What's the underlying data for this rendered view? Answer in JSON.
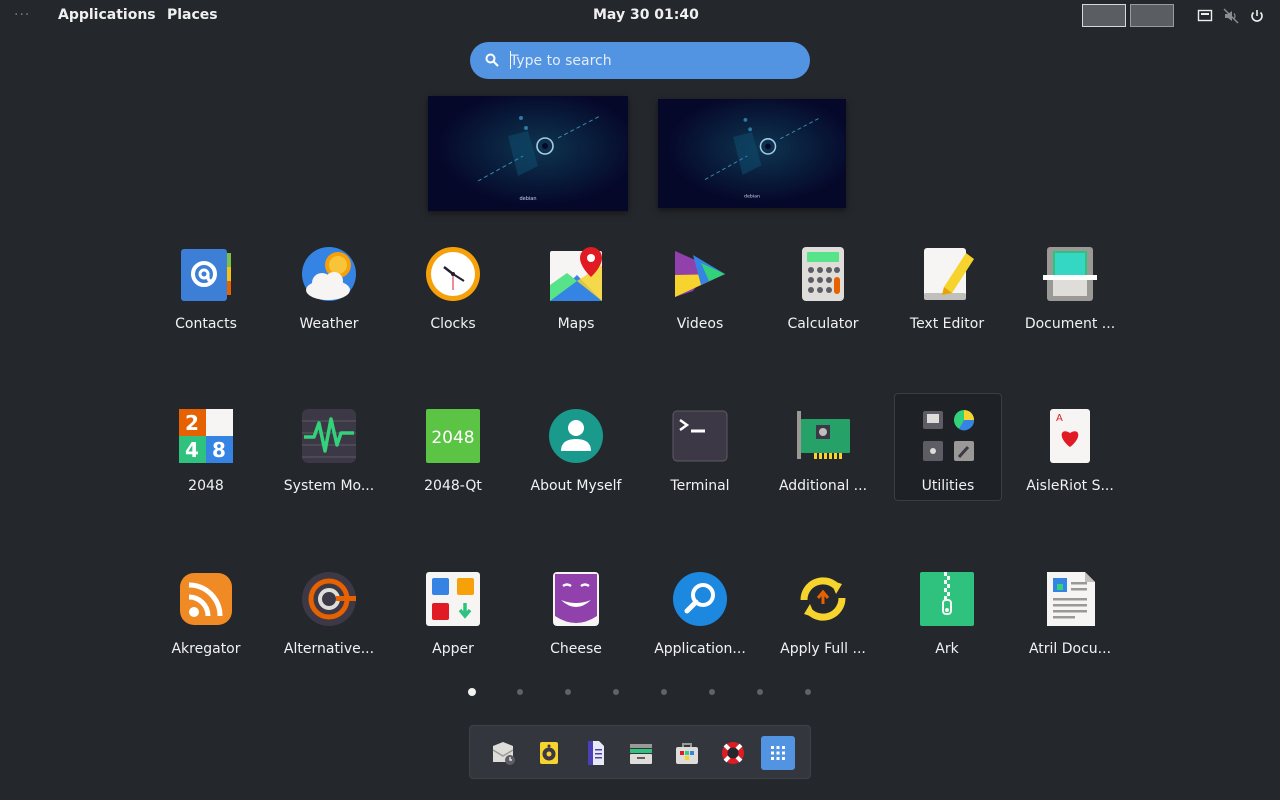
{
  "topbar": {
    "activities": "···",
    "applications": "Applications",
    "places": "Places",
    "clock": "May 30  01:40"
  },
  "search": {
    "placeholder": "Type to search"
  },
  "apps": [
    {
      "label": "Contacts",
      "icon": "contacts-icon"
    },
    {
      "label": "Weather",
      "icon": "weather-icon"
    },
    {
      "label": "Clocks",
      "icon": "clocks-icon"
    },
    {
      "label": "Maps",
      "icon": "maps-icon"
    },
    {
      "label": "Videos",
      "icon": "videos-icon"
    },
    {
      "label": "Calculator",
      "icon": "calculator-icon"
    },
    {
      "label": "Text Editor",
      "icon": "text-editor-icon"
    },
    {
      "label": "Document ...",
      "icon": "document-scanner-icon"
    },
    {
      "label": "2048",
      "icon": "2048-icon"
    },
    {
      "label": "System Mo...",
      "icon": "system-monitor-icon"
    },
    {
      "label": "2048-Qt",
      "icon": "2048-qt-icon",
      "icon_text": "2048"
    },
    {
      "label": "About Myself",
      "icon": "about-myself-icon"
    },
    {
      "label": "Terminal",
      "icon": "terminal-icon"
    },
    {
      "label": "Additional ...",
      "icon": "additional-drivers-icon"
    },
    {
      "label": "Utilities",
      "icon": "utilities-folder-icon"
    },
    {
      "label": "AisleRiot S...",
      "icon": "aisleriot-icon"
    },
    {
      "label": "Akregator",
      "icon": "akregator-icon"
    },
    {
      "label": "Alternative...",
      "icon": "alternatives-icon"
    },
    {
      "label": "Apper",
      "icon": "apper-icon"
    },
    {
      "label": "Cheese",
      "icon": "cheese-icon"
    },
    {
      "label": "Application...",
      "icon": "application-finder-icon"
    },
    {
      "label": "Apply Full ...",
      "icon": "apply-upgrade-icon"
    },
    {
      "label": "Ark",
      "icon": "ark-icon"
    },
    {
      "label": "Atril Docu...",
      "icon": "atril-icon"
    }
  ],
  "tile_digits": [
    "2",
    "4",
    "8"
  ],
  "wallpaper_caption": "debian",
  "pages": {
    "count": 8,
    "current": 1
  },
  "dock": [
    {
      "name": "mail-icon"
    },
    {
      "name": "rhythmbox-icon"
    },
    {
      "name": "document-viewer-icon"
    },
    {
      "name": "file-manager-icon"
    },
    {
      "name": "software-center-icon"
    },
    {
      "name": "help-icon"
    },
    {
      "name": "show-applications-icon"
    }
  ],
  "colors": {
    "accent": "#5294e2",
    "background": "#24272c"
  }
}
